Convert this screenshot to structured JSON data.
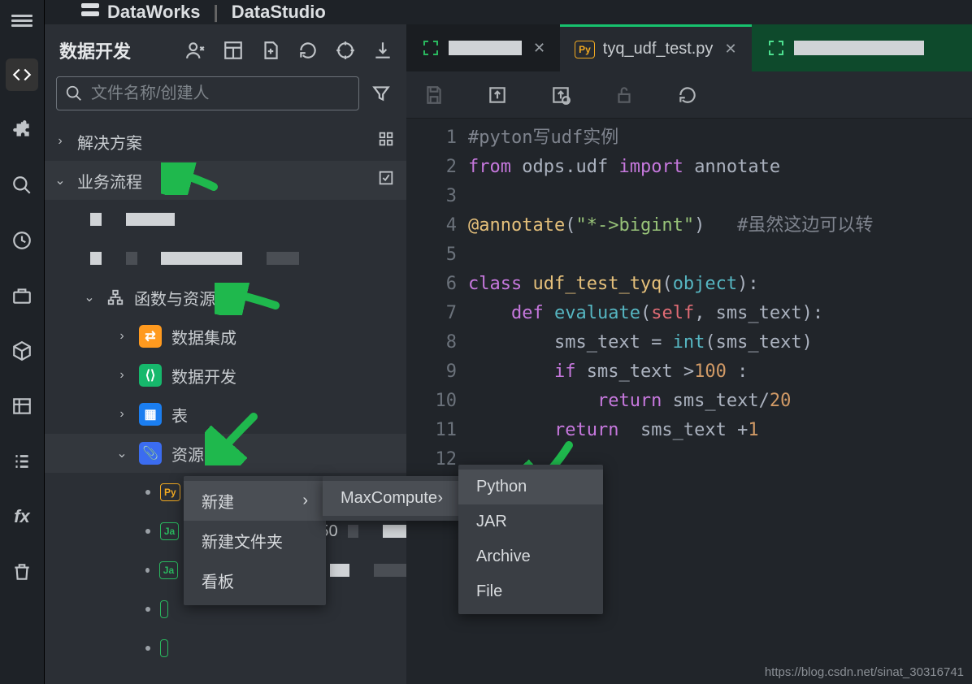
{
  "brand": {
    "name": "DataWorks",
    "sub": "DataStudio"
  },
  "sidebar": {
    "title": "数据开发",
    "search_placeholder": "文件名称/创建人",
    "sections": {
      "solutions": "解决方案",
      "workflow": "业务流程",
      "func_res": "函数与资源",
      "data_integ": "数据集成",
      "data_dev": "数据开发",
      "tables": "表",
      "resources": "资源"
    }
  },
  "resource_badges": {
    "py": "Py",
    "ja": "Ja"
  },
  "context": {
    "new": "新建",
    "new_folder": "新建文件夹",
    "kanban": "看板",
    "maxcompute": "MaxCompute",
    "types": {
      "python": "Python",
      "jar": "JAR",
      "archive": "Archive",
      "file": "File"
    }
  },
  "tabs": {
    "active_file": "tyq_udf_test.py",
    "active_icon": "Py"
  },
  "code": {
    "lines": [
      {
        "n": 1,
        "html": "<span class='c-comment'>#pyton写udf实例</span>"
      },
      {
        "n": 2,
        "html": "<span class='c-kw'>from</span> <span class='c-mod'>odps.udf</span> <span class='c-kw'>import</span> <span class='c-mod'>annotate</span>"
      },
      {
        "n": 3,
        "html": ""
      },
      {
        "n": 4,
        "html": "<span class='c-dec'>@annotate</span>(<span class='c-str'>\"*-&gt;bigint\"</span>)   <span class='c-comment'>#虽然这边可以转</span>"
      },
      {
        "n": 5,
        "html": ""
      },
      {
        "n": 6,
        "html": "<span class='c-kw'>class</span> <span class='c-cls'>udf_test_tyq</span>(<span class='c-fn'>object</span>):"
      },
      {
        "n": 7,
        "html": "    <span class='c-kw'>def</span> <span class='c-fn'>evaluate</span>(<span class='c-self'>self</span>, sms_text):"
      },
      {
        "n": 8,
        "html": "        sms_text = <span class='c-fn'>int</span>(sms_text)"
      },
      {
        "n": 9,
        "html": "        <span class='c-kw'>if</span> sms_text &gt;<span class='c-num'>100</span> :"
      },
      {
        "n": 10,
        "html": "            <span class='c-kw'>return</span> sms_text/<span class='c-num'>20</span>"
      },
      {
        "n": 11,
        "html": "        <span class='c-kw'>return</span>  sms_text +<span class='c-num'>1</span>"
      },
      {
        "n": 12,
        "html": ""
      }
    ]
  },
  "watermark": "https://blog.csdn.net/sinat_30316741"
}
